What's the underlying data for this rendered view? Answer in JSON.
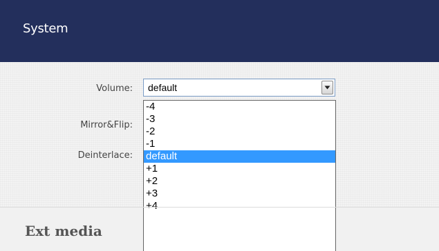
{
  "header": {
    "title": "System"
  },
  "form": {
    "volume_label": "Volume:",
    "mirror_label": "Mirror&Flip:",
    "deinterlace_label": "Deinterlace:"
  },
  "volume_select": {
    "value": "default",
    "options": [
      "-4",
      "-3",
      "-2",
      "-1",
      "default",
      "+1",
      "+2",
      "+3",
      "+4"
    ],
    "selected_option": "default"
  },
  "next_section": {
    "title": "Ext media"
  },
  "colors": {
    "header_bg": "#232f5c",
    "selection_bg": "#3399ff",
    "select_border": "#7a9cc6"
  },
  "icons": {
    "dropdown": "triangle-down-icon"
  }
}
